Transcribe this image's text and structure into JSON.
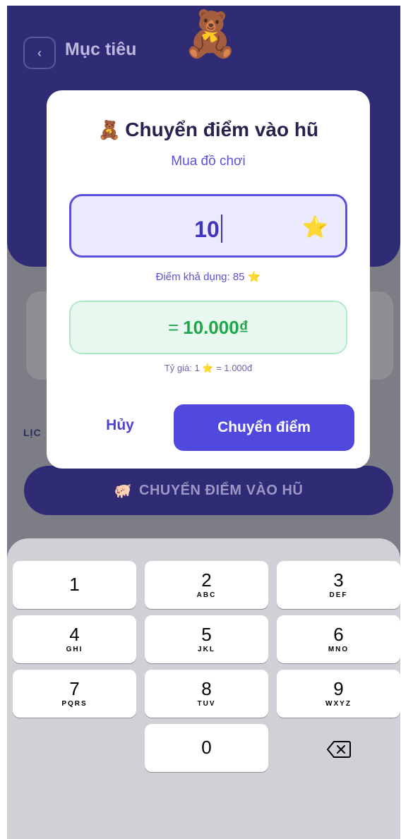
{
  "background": {
    "back_icon": "chevron-left-icon",
    "back_glyph": "‹",
    "page_title": "Mục tiêu",
    "bear_icon": "teddy-bear-icon",
    "bear_glyph": "🧸",
    "history_label": "LỊC",
    "cta_icon": "piggy-bank-icon",
    "cta_glyph": "🐖",
    "cta_label": "CHUYỂN ĐIỂM VÀO HŨ"
  },
  "modal": {
    "title_icon": "teddy-bear-icon",
    "title_glyph": "🧸",
    "title": "Chuyển điểm vào hũ",
    "subtitle": "Mua đồ chơi",
    "amount_value": "10",
    "star_glyph": "⭐",
    "available_label": "Điểm khả dụng: 85",
    "conversion_prefix": "=",
    "conversion_value": "10.000₫",
    "rate_prefix": "Tỷ giá: 1",
    "rate_suffix": "= 1.000đ",
    "cancel_label": "Hủy",
    "confirm_label": "Chuyển điểm"
  },
  "keyboard": {
    "keys": [
      {
        "num": "1",
        "letters": ""
      },
      {
        "num": "2",
        "letters": "ABC"
      },
      {
        "num": "3",
        "letters": "DEF"
      },
      {
        "num": "4",
        "letters": "GHI"
      },
      {
        "num": "5",
        "letters": "JKL"
      },
      {
        "num": "6",
        "letters": "MNO"
      },
      {
        "num": "7",
        "letters": "PQRS"
      },
      {
        "num": "8",
        "letters": "TUV"
      },
      {
        "num": "9",
        "letters": "WXYZ"
      },
      {
        "num": "0",
        "letters": ""
      }
    ],
    "delete_icon": "backspace-icon"
  }
}
